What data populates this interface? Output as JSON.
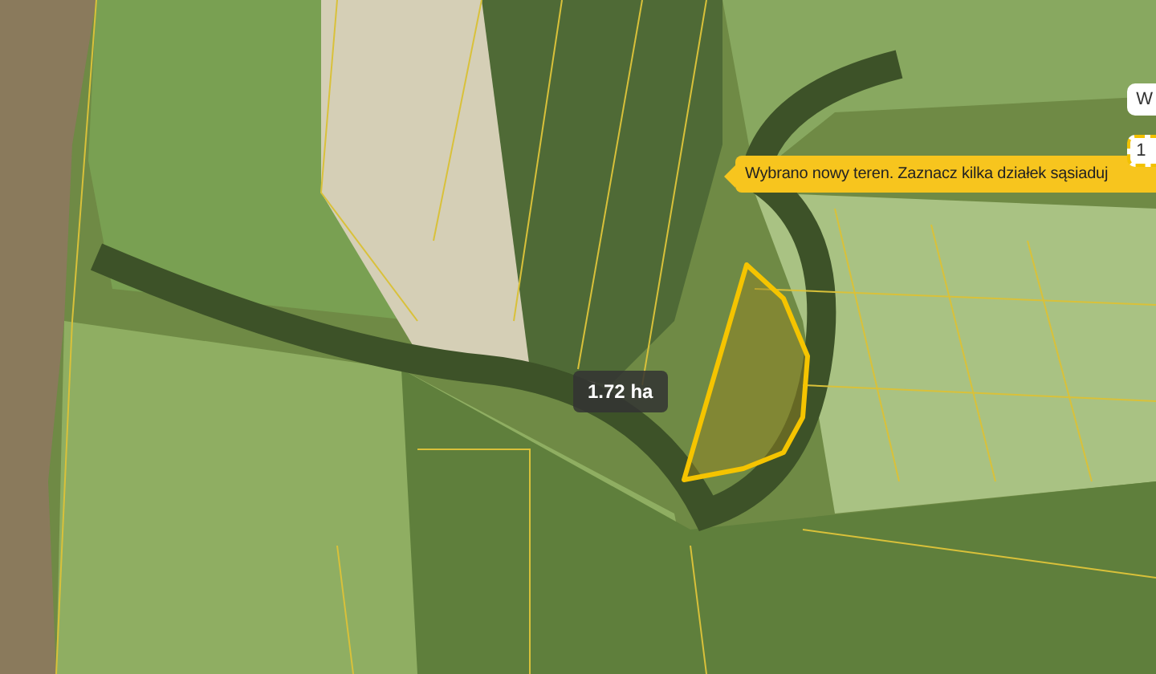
{
  "map": {
    "area_label": "1.72 ha"
  },
  "tooltip": {
    "text": "Wybrano nowy teren. Zaznacz kilka działek sąsiaduj"
  },
  "side_controls": [
    {
      "text": "W",
      "highlighted": false
    },
    {
      "text": "1",
      "highlighted": true
    }
  ]
}
